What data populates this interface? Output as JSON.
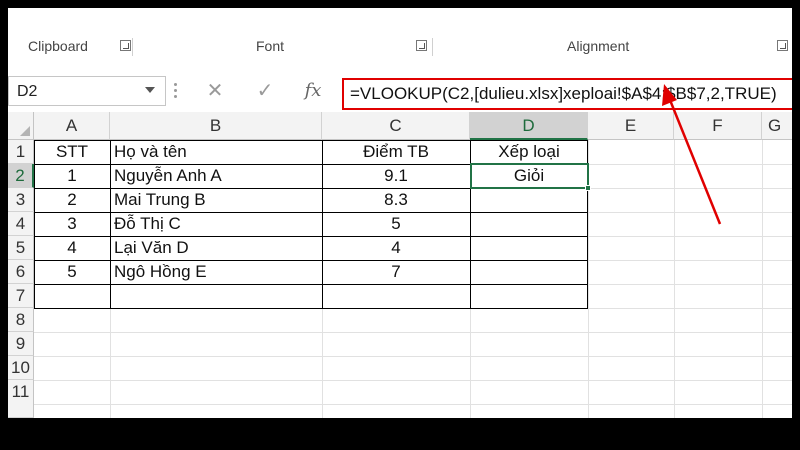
{
  "ribbon": {
    "groups": [
      {
        "label": "Clipboard"
      },
      {
        "label": "Font"
      },
      {
        "label": "Alignment"
      }
    ]
  },
  "formula_bar": {
    "name_box": "D2",
    "cancel_symbol": "✕",
    "enter_symbol": "✓",
    "fx_label": "fx",
    "formula": "=VLOOKUP(C2,[dulieu.xlsx]xeploai!$A$4:$B$7,2,TRUE)"
  },
  "sheet": {
    "columns": [
      "A",
      "B",
      "C",
      "D",
      "E",
      "F",
      "G"
    ],
    "rows": [
      "1",
      "2",
      "3",
      "4",
      "5",
      "6",
      "7",
      "8",
      "9",
      "10",
      "11"
    ],
    "header_row": {
      "stt": "STT",
      "name": "Họ và tên",
      "score": "Điểm TB",
      "grade": "Xếp loại"
    },
    "data_rows": [
      {
        "stt": "1",
        "name": "Nguyễn Anh A",
        "score": "9.1",
        "grade": "Giỏi"
      },
      {
        "stt": "2",
        "name": "Mai Trung B",
        "score": "8.3",
        "grade": ""
      },
      {
        "stt": "3",
        "name": "Đỗ Thị C",
        "score": "5",
        "grade": ""
      },
      {
        "stt": "4",
        "name": "Lại Văn D",
        "score": "4",
        "grade": ""
      },
      {
        "stt": "5",
        "name": "Ngô Hồng E",
        "score": "7",
        "grade": ""
      }
    ],
    "active_cell": "D2"
  },
  "colors": {
    "highlight_box": "#e00000",
    "arrow": "#e00000",
    "selection": "#217346"
  },
  "annotation": {
    "type": "arrow-icon"
  }
}
